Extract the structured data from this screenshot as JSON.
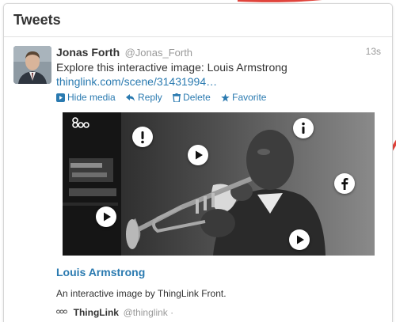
{
  "panel": {
    "title": "Tweets"
  },
  "tweet": {
    "fullname": "Jonas Forth",
    "username": "@Jonas_Forth",
    "time": "13s",
    "text": "Explore this interactive image: Louis Armstrong",
    "link": "thinglink.com/scene/31431994…",
    "actions": {
      "hide_media": "Hide media",
      "reply": "Reply",
      "delete": "Delete",
      "favorite": "Favorite"
    }
  },
  "media": {
    "hotspots": [
      "alert-icon",
      "play-icon",
      "info-icon",
      "facebook-icon",
      "play-icon",
      "play-icon"
    ]
  },
  "card": {
    "title": "Louis Armstrong",
    "description": "An interactive image by ThingLink Front.",
    "author_name": "ThingLink",
    "author_handle": "@thinglink ·"
  },
  "colors": {
    "link": "#2a7ab0",
    "muted": "#999999",
    "accent_arc": "#e0443c"
  }
}
